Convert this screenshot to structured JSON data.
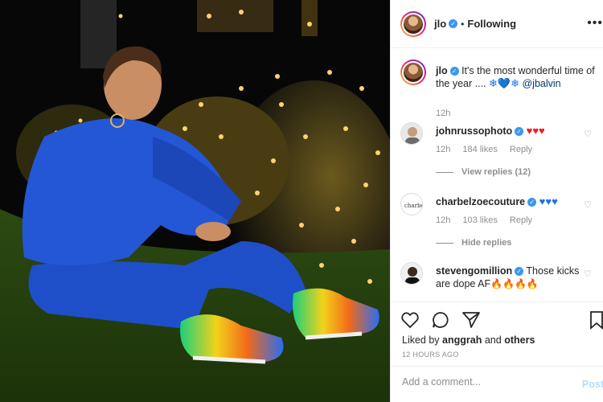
{
  "post": {
    "username": "jlo",
    "follow_status": "Following",
    "more_icon": "more-icon"
  },
  "caption": {
    "username": "jlo",
    "text": "It's the most wonderful time of the year .... ",
    "emoji": "❄💙❄",
    "mention": "@jbalvin",
    "time": "12h"
  },
  "comments": [
    {
      "username": "johnrussophoto",
      "text": "",
      "emoji": "♥♥♥",
      "time": "12h",
      "likes": "184 likes",
      "reply": "Reply",
      "replies_toggle": "View replies (12)"
    },
    {
      "username": "charbelzoecouture",
      "text": "",
      "emoji": "♥♥♥",
      "time": "12h",
      "likes": "103 likes",
      "reply": "Reply",
      "replies_toggle": "Hide replies"
    },
    {
      "username": "stevengomillion",
      "text": "Those kicks are dope AF",
      "emoji": "🔥🔥🔥🔥"
    }
  ],
  "actions": {
    "liked_prefix": "Liked by",
    "liked_user": "anggrah",
    "liked_and": "and",
    "liked_others": "others",
    "timestamp": "12 HOURS AGO"
  },
  "add_comment": {
    "placeholder": "Add a comment...",
    "post_label": "Post"
  },
  "colors": {
    "verified": "#3897f0",
    "link": "#00376b",
    "muted": "#8e8e8e",
    "sweatsuit": "#1f4fc8"
  }
}
